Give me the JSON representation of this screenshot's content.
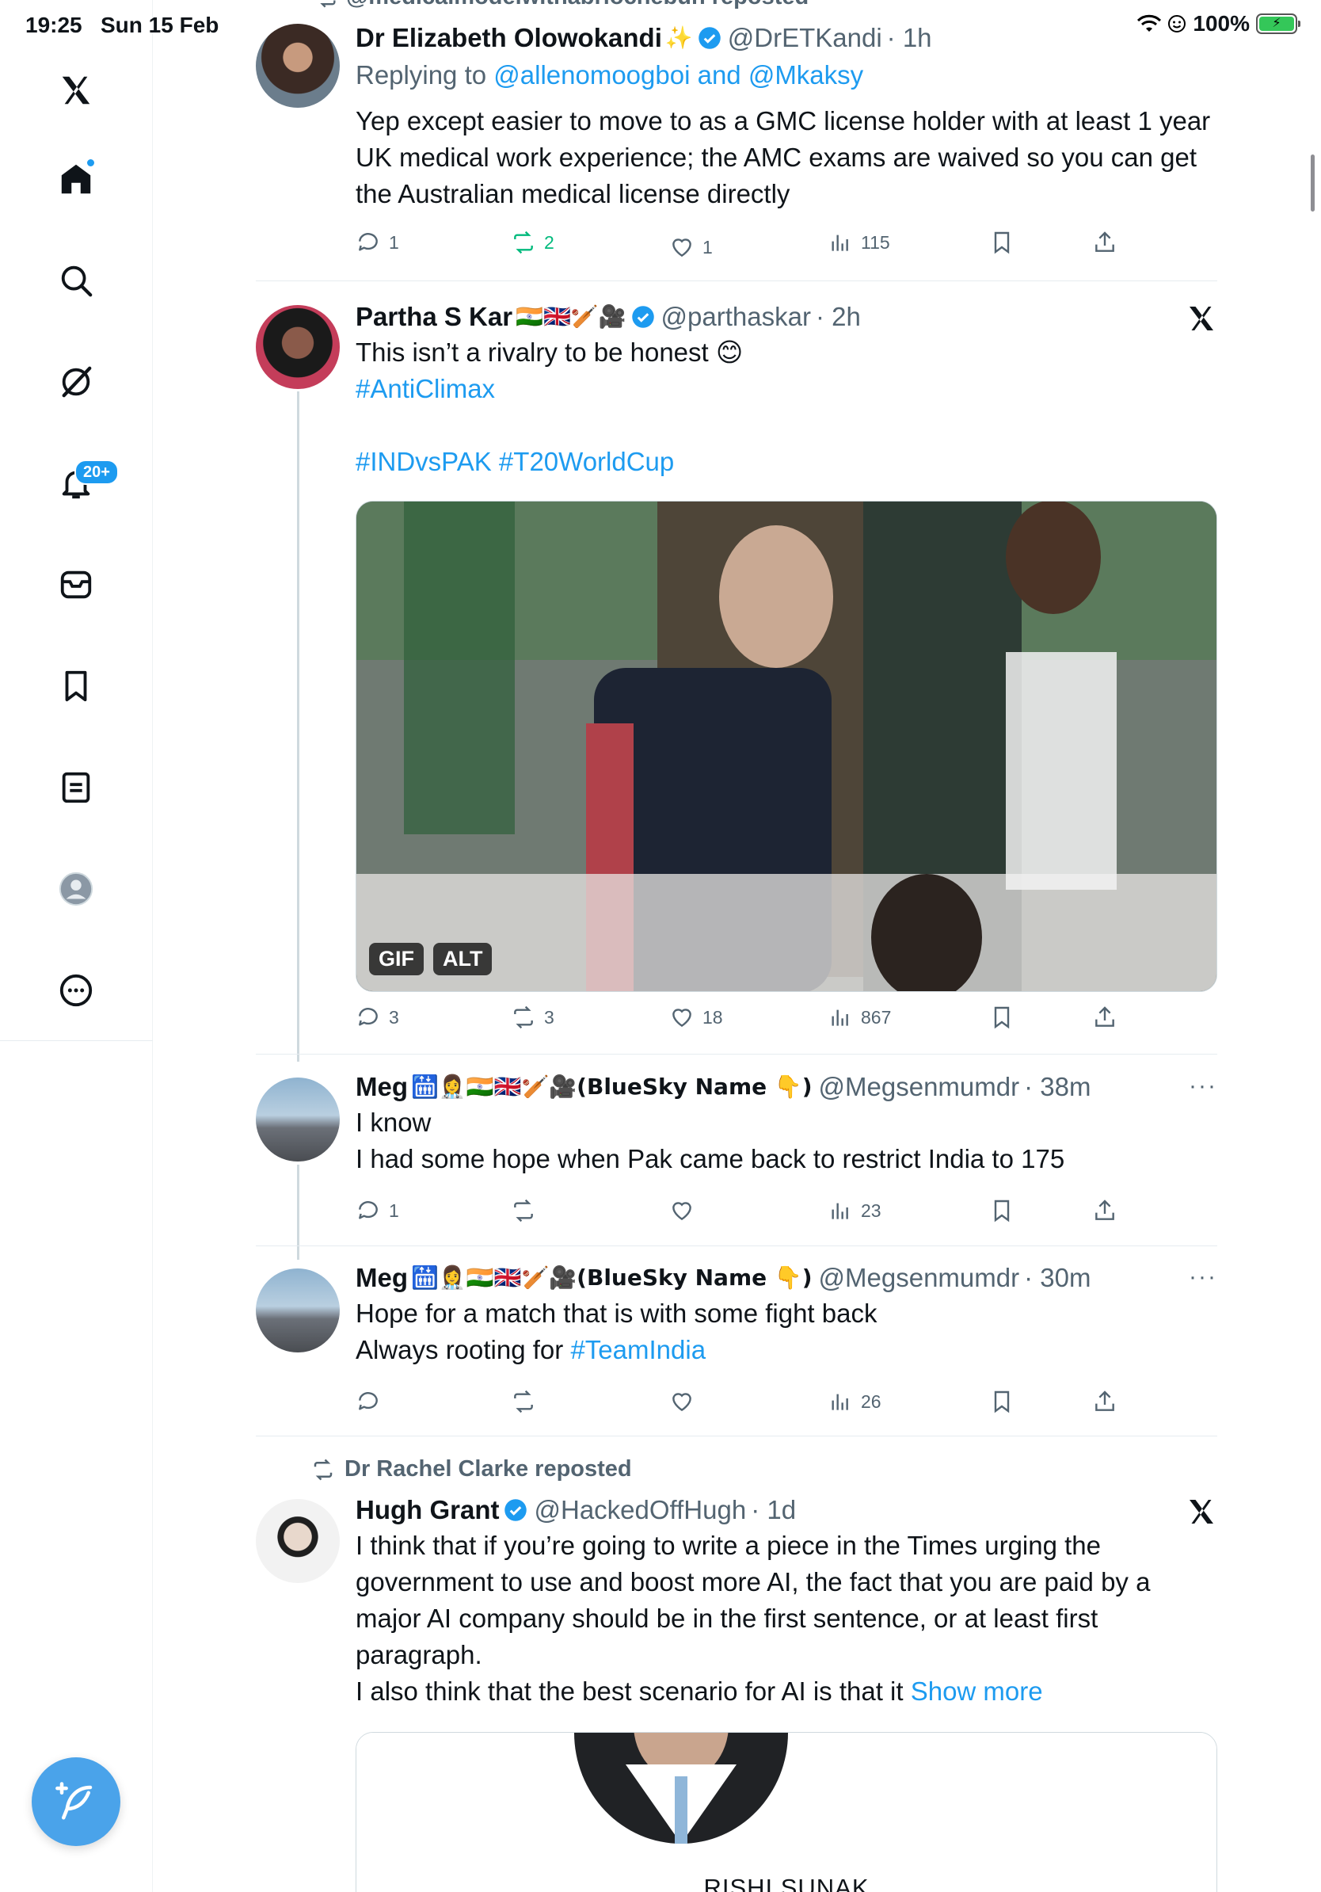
{
  "status_bar": {
    "time": "19:25",
    "date": "Sun 15 Feb",
    "battery": "100%"
  },
  "sidebar": {
    "items": [
      {
        "name": "x-logo-icon"
      },
      {
        "name": "home-icon",
        "has_dot": true
      },
      {
        "name": "search-icon"
      },
      {
        "name": "grok-icon"
      },
      {
        "name": "notifications-icon",
        "badge": "20+"
      },
      {
        "name": "messages-icon"
      },
      {
        "name": "bookmarks-icon"
      },
      {
        "name": "lists-icon"
      },
      {
        "name": "profile-icon"
      },
      {
        "name": "more-icon"
      }
    ],
    "accent": "#1d9bf0"
  },
  "feed": {
    "partial_top": "@medicalmodelwithabriochebun reposted",
    "tweets": [
      {
        "author": "Dr Elizabeth Olowokandi",
        "emoji": "✨",
        "handle": "@DrETKandi",
        "time": "· 1h",
        "reply_prefix": "Replying to ",
        "reply_to": "@allenomoogboi and @Mkaksy",
        "text": "Yep except easier to move to as a GMC license holder with at least 1 year UK medical work experience; the AMC exams are waived so you can get the Australian medical license directly",
        "replies": "1",
        "reposts": "2",
        "likes": "1",
        "views": "115"
      },
      {
        "author": "Partha S Kar",
        "emoji": "🇮🇳🇬🇧🏏🎥",
        "handle": "@parthaskar",
        "time": "· 2h",
        "text_line1": "This isn’t a rivalry to be honest 😊",
        "hashtag1": "#AntiClimax",
        "hashtag2": "#INDvsPAK #T20WorldCup",
        "media_badge_gif": "GIF",
        "media_badge_alt": "ALT",
        "replies": "3",
        "reposts": "3",
        "likes": "18",
        "views": "867"
      },
      {
        "author": "Meg",
        "emoji": "🛗👩‍⚕️🇮🇳🇬🇧🏏🎥(BlueSky Name 👇)",
        "handle": "@Megsenmumdr",
        "time": "· 38m",
        "text_line1": "I know",
        "text_line2": "I had some hope when Pak came back to restrict India to 175",
        "replies": "1",
        "reposts": "",
        "likes": "",
        "views": "23"
      },
      {
        "author": "Meg",
        "emoji": "🛗👩‍⚕️🇮🇳🇬🇧🏏🎥(BlueSky Name 👇)",
        "handle": "@Megsenmumdr",
        "time": "· 30m",
        "text_line1": "Hope for a match that is with some fight back",
        "text_line2_prefix": "Always rooting for ",
        "text_line2_tag": "#TeamIndia",
        "replies": "",
        "reposts": "",
        "likes": "",
        "views": "26"
      },
      {
        "repost_label": "Dr Rachel Clarke reposted",
        "author": "Hugh Grant",
        "handle": "@HackedOffHugh",
        "time": "· 1d",
        "text": "I think that if you’re going to write a piece in the Times urging the government to use and boost more AI, the fact that you are paid by a major AI company should be in the first sentence, or at least first paragraph.",
        "text_line2": "I also think that the best scenario for AI is that it ",
        "show_more": "Show more",
        "card_caption": "RISHI SUNAK"
      }
    ]
  }
}
